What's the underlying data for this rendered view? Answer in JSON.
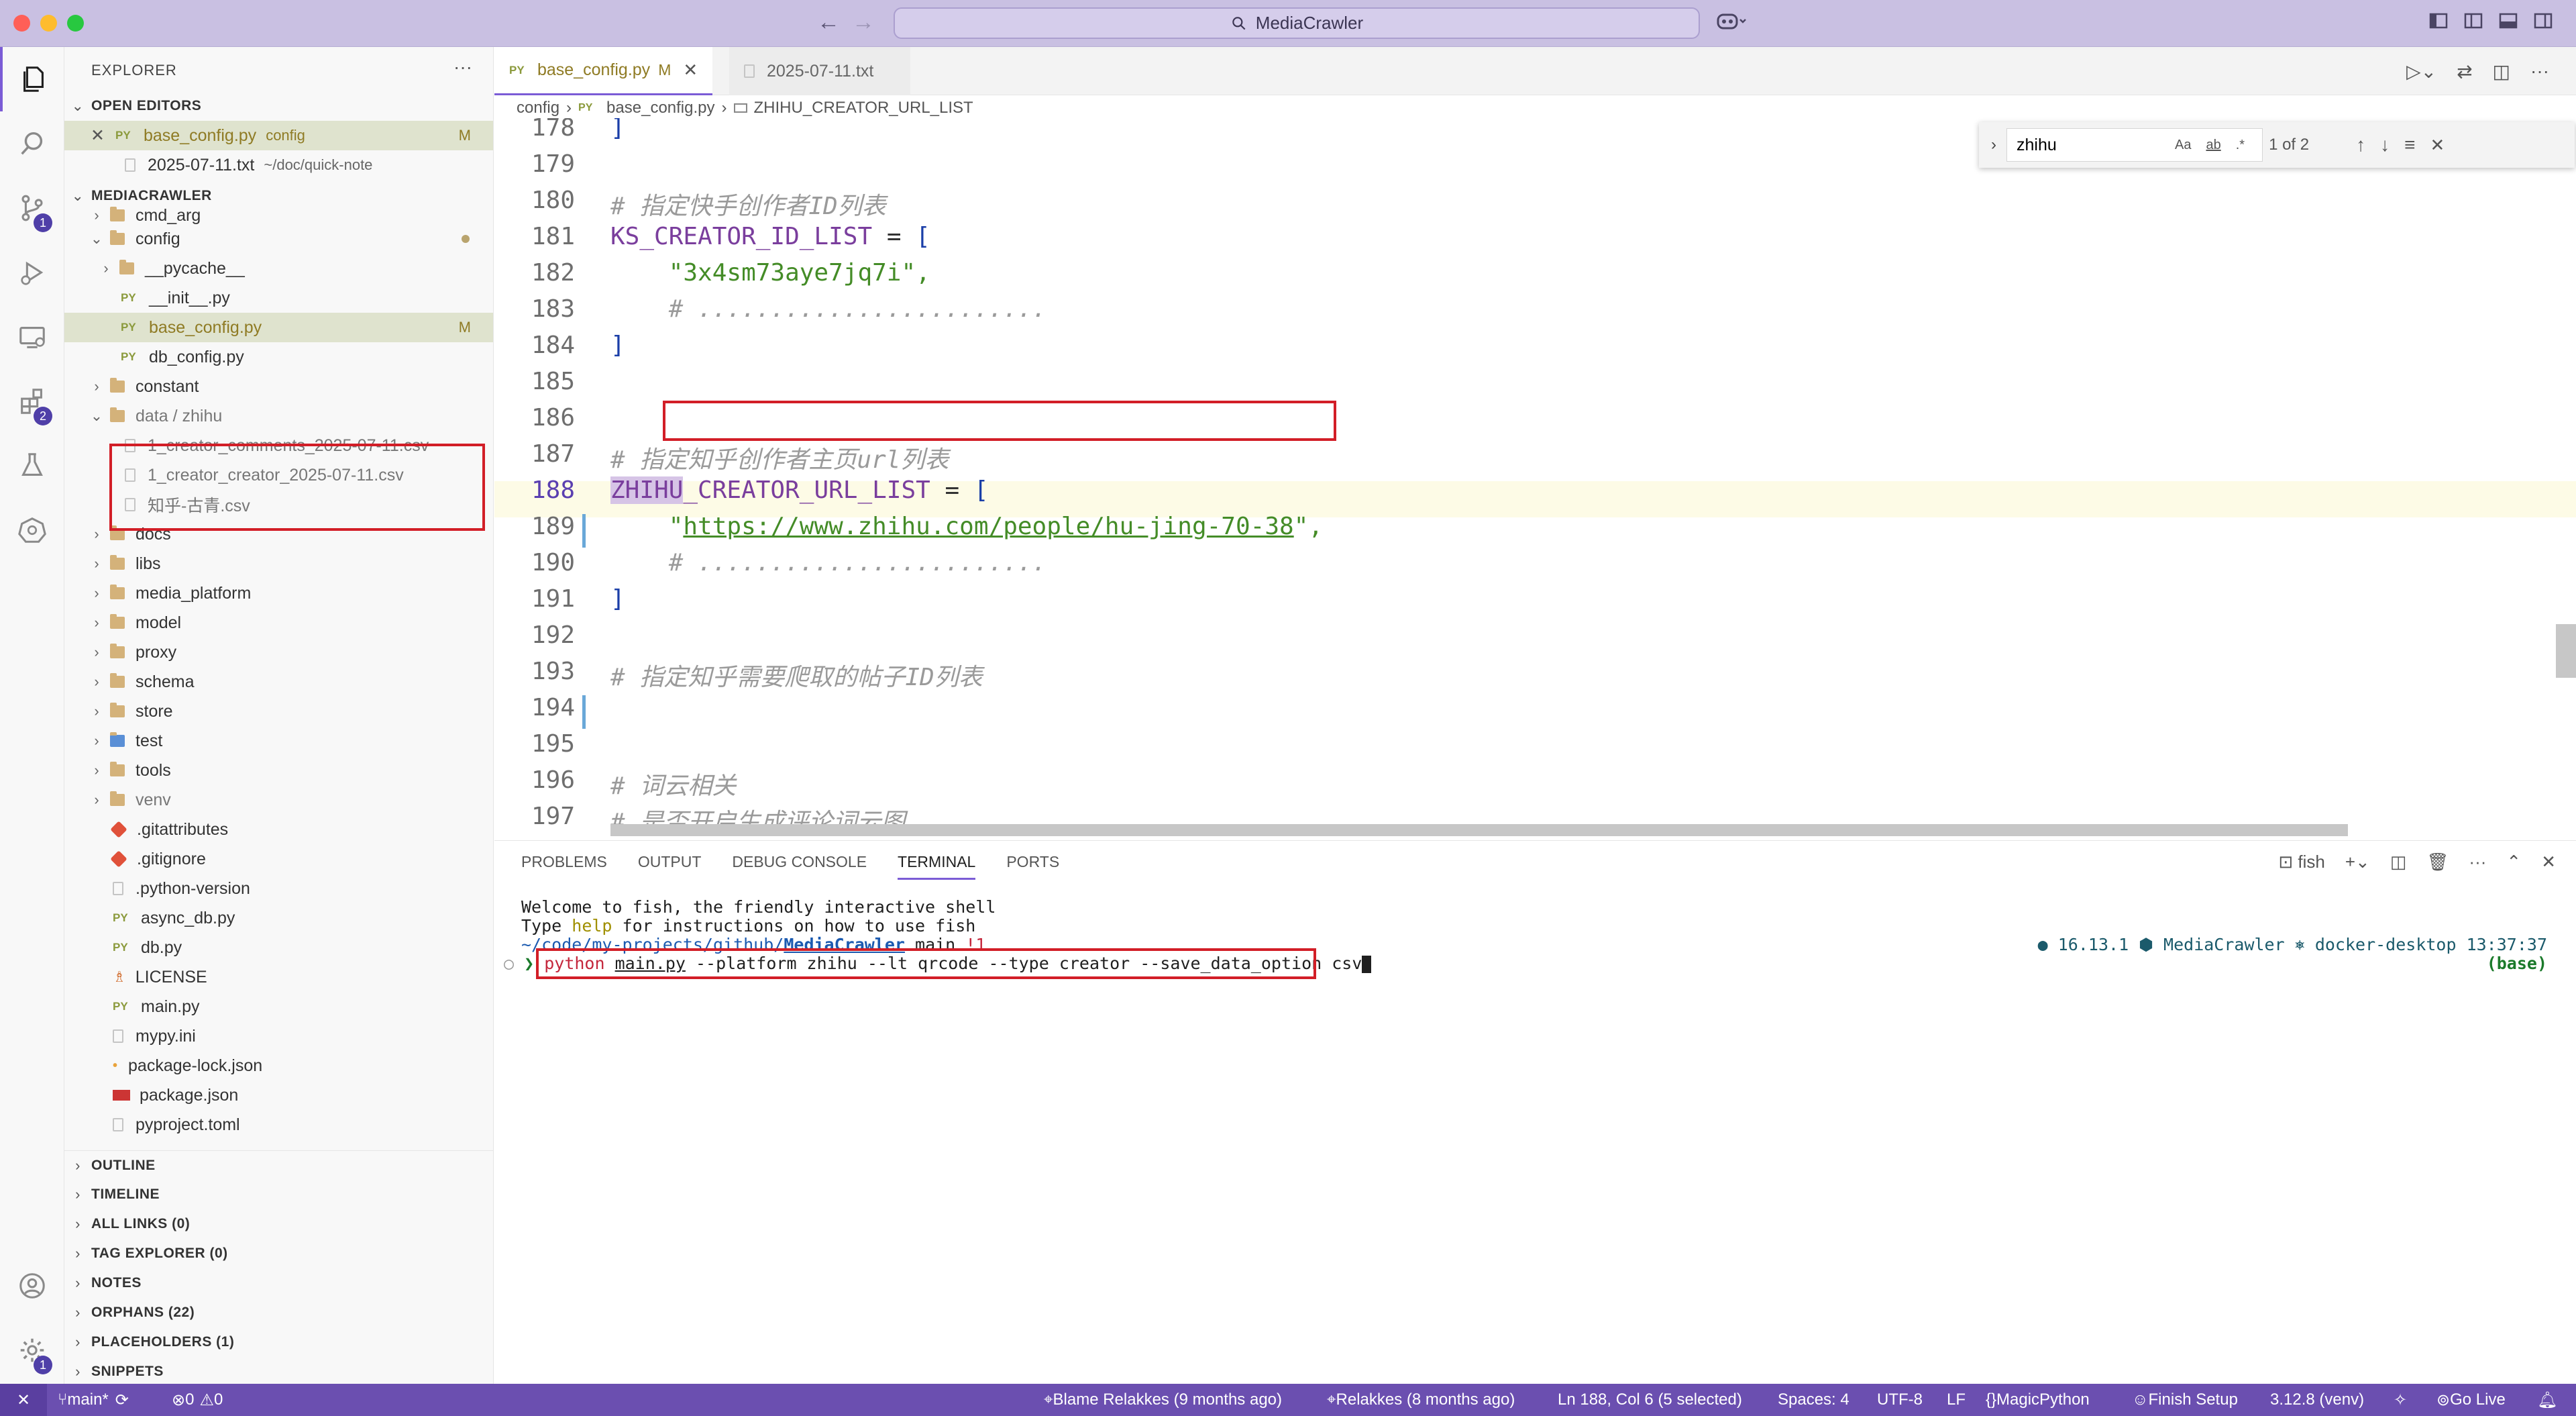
{
  "titlebar": {
    "search_text": "MediaCrawler"
  },
  "activity_badges": {
    "scm": "1",
    "extensions": "2",
    "settings": "1"
  },
  "sidebar": {
    "title": "EXPLORER",
    "more": "···",
    "open_editors_title": "OPEN EDITORS",
    "open_editors": [
      {
        "name": "base_config.py",
        "desc": "config",
        "badge": "M"
      },
      {
        "name": "2025-07-11.txt",
        "desc": "~/doc/quick-note"
      }
    ],
    "project_title": "MEDIACRAWLER",
    "tree": [
      {
        "name": "cmd_arg"
      },
      {
        "name": "config"
      },
      {
        "name": "__pycache__"
      },
      {
        "name": "__init__.py"
      },
      {
        "name": "base_config.py",
        "badge": "M"
      },
      {
        "name": "db_config.py"
      },
      {
        "name": "constant"
      },
      {
        "name": "data / zhihu"
      },
      {
        "name": "1_creator_comments_2025-07-11.csv"
      },
      {
        "name": "1_creator_creator_2025-07-11.csv"
      },
      {
        "name": "知乎-古青.csv"
      },
      {
        "name": "docs"
      },
      {
        "name": "libs"
      },
      {
        "name": "media_platform"
      },
      {
        "name": "model"
      },
      {
        "name": "proxy"
      },
      {
        "name": "schema"
      },
      {
        "name": "store"
      },
      {
        "name": "test"
      },
      {
        "name": "tools"
      },
      {
        "name": "venv"
      },
      {
        "name": ".gitattributes"
      },
      {
        "name": ".gitignore"
      },
      {
        "name": ".python-version"
      },
      {
        "name": "async_db.py"
      },
      {
        "name": "db.py"
      },
      {
        "name": "LICENSE"
      },
      {
        "name": "main.py"
      },
      {
        "name": "mypy.ini"
      },
      {
        "name": "package-lock.json"
      },
      {
        "name": "package.json"
      },
      {
        "name": "pyproject.toml"
      }
    ],
    "sections": [
      "OUTLINE",
      "TIMELINE",
      "ALL LINKS (0)",
      "TAG EXPLORER (0)",
      "NOTES",
      "ORPHANS (22)",
      "PLACEHOLDERS (1)",
      "SNIPPETS"
    ]
  },
  "tabs": [
    {
      "name": "base_config.py",
      "modified": "M"
    },
    {
      "name": "2025-07-11.txt"
    }
  ],
  "breadcrumb": {
    "folder": "config",
    "file": "base_config.py",
    "symbol": "ZHIHU_CREATOR_URL_LIST"
  },
  "find": {
    "query": "zhihu",
    "count": "1 of 2",
    "case": "Aa",
    "word": "ab",
    "regex": ".*"
  },
  "editor": {
    "line_numbers": [
      "178",
      "179",
      "180",
      "181",
      "182",
      "183",
      "184",
      "185",
      "186",
      "187",
      "188",
      "189",
      "190",
      "191",
      "192",
      "193",
      "194",
      "195",
      "196",
      "197"
    ],
    "lines": {
      "l178": "]",
      "l180": "# 指定快手创作者ID列表",
      "l181_name": "KS_CREATOR_ID_LIST",
      "l181_rest": " = ",
      "l181_br": "[",
      "l182": "    \"3x4sm73aye7jq7i\",",
      "l183": "    # ........................",
      "l184": "]",
      "l187": "# 指定知乎创作者主页url列表",
      "l188_hl": "ZHIHU",
      "l188_name": "_CREATOR_URL_LIST",
      "l188_rest": " = ",
      "l188_br": "[",
      "l189_q": "    \"",
      "l189_url": "https://www.zhihu.com/people/hu-jing-70-38",
      "l189_end": "\",",
      "l190": "    # ........................",
      "l191": "]",
      "l193": "# 指定知乎需要爬取的帖子ID列表",
      "l196": "# 词云相关",
      "l197": "# 是否开启生成评论词云图"
    }
  },
  "panel": {
    "tabs": [
      "PROBLEMS",
      "OUTPUT",
      "DEBUG CONSOLE",
      "TERMINAL",
      "PORTS"
    ],
    "active_tab": "TERMINAL",
    "shell": "fish",
    "terminal": {
      "welcome": "Welcome to fish, the friendly interactive shell",
      "help_pre": "Type ",
      "help_word": "help",
      "help_post": " for instructions on how to use fish",
      "path": "~/code/my-projects/github/",
      "path_bold": "MediaCrawler",
      "branch": " main ",
      "branch_flag": "!1",
      "right_info": "● 16.13.1 ⬢ MediaCrawler ⎈ docker-desktop 13:37:37",
      "right_env": "(base)",
      "prompt": "❯ ",
      "cmd_py": "python ",
      "cmd_main": "main.py",
      "cmd_args": " --platform zhihu --lt qrcode --type creator --save_data_option csv"
    }
  },
  "status": {
    "branch": "main*",
    "errors": "0",
    "warnings": "0",
    "blame": "Blame Relakkes (9 months ago)",
    "commit": "Relakkes (8 months ago)",
    "position": "Ln 188, Col 6 (5 selected)",
    "spaces": "Spaces: 4",
    "encoding": "UTF-8",
    "eol": "LF",
    "language": "MagicPython",
    "finish_setup": "Finish Setup",
    "python": "3.12.8 (venv)",
    "golive": "Go Live"
  },
  "colors": {
    "accent": "#6b4fb0",
    "highlight_box": "#d21e27",
    "titlebar": "#c9c0e2"
  }
}
